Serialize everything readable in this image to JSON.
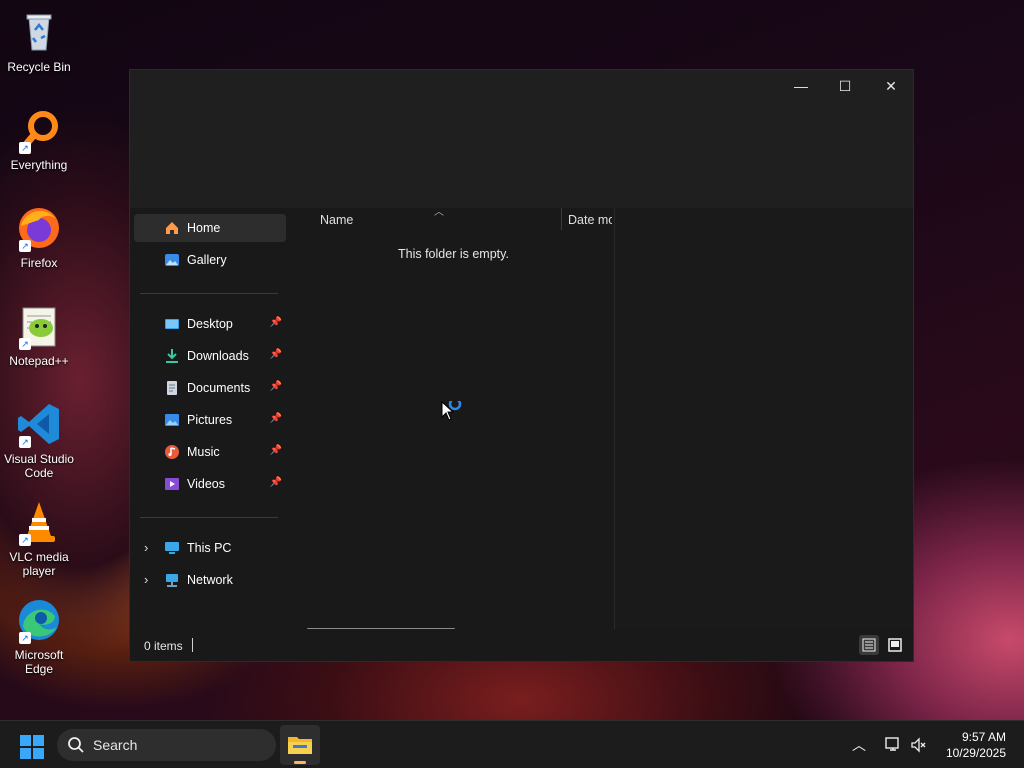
{
  "desktop": {
    "icons": [
      {
        "label": "Recycle Bin"
      },
      {
        "label": "Everything"
      },
      {
        "label": "Firefox"
      },
      {
        "label": "Notepad++"
      },
      {
        "label": "Visual Studio Code"
      },
      {
        "label": "VLC media player"
      },
      {
        "label": "Microsoft Edge"
      }
    ]
  },
  "window": {
    "controls": {
      "minimize": "—",
      "maximize": "☐",
      "close": "✕"
    },
    "sidebar": {
      "items": [
        {
          "label": "Home"
        },
        {
          "label": "Gallery"
        },
        {
          "label": "Desktop"
        },
        {
          "label": "Downloads"
        },
        {
          "label": "Documents"
        },
        {
          "label": "Pictures"
        },
        {
          "label": "Music"
        },
        {
          "label": "Videos"
        },
        {
          "label": "This PC"
        },
        {
          "label": "Network"
        }
      ]
    },
    "columns": {
      "name": "Name",
      "date": "Date mo"
    },
    "empty_message": "This folder is empty.",
    "status": {
      "items": "0 items"
    }
  },
  "taskbar": {
    "search_placeholder": "Search",
    "time": "9:57 AM",
    "date": "10/29/2025"
  },
  "colors": {
    "accent": "#0078d4",
    "selected": "#2d2d2d"
  }
}
